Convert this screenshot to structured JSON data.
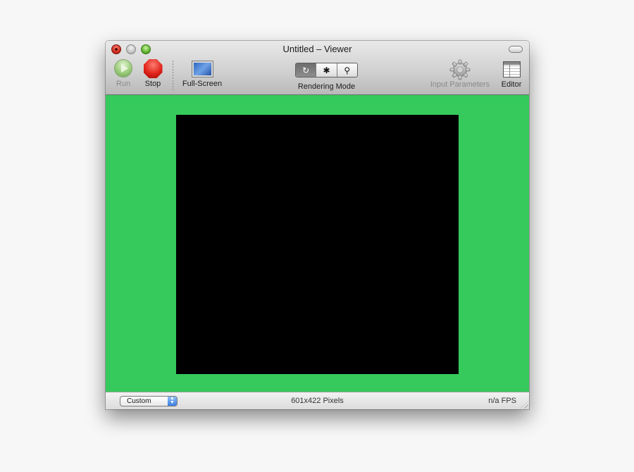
{
  "window": {
    "title": "Untitled – Viewer"
  },
  "toolbar": {
    "run_label": "Run",
    "stop_label": "Stop",
    "fullscreen_label": "Full-Screen",
    "rendering_mode_label": "Rendering Mode",
    "rendering_modes": [
      "↻",
      "✱",
      "⚲"
    ],
    "input_parameters_label": "Input Parameters",
    "editor_label": "Editor"
  },
  "viewer": {
    "background_color": "#35ca5b",
    "canvas_color": "#000000"
  },
  "statusbar": {
    "size_preset": "Custom",
    "pixel_size": "601x422 Pixels",
    "fps": "n/a FPS"
  }
}
